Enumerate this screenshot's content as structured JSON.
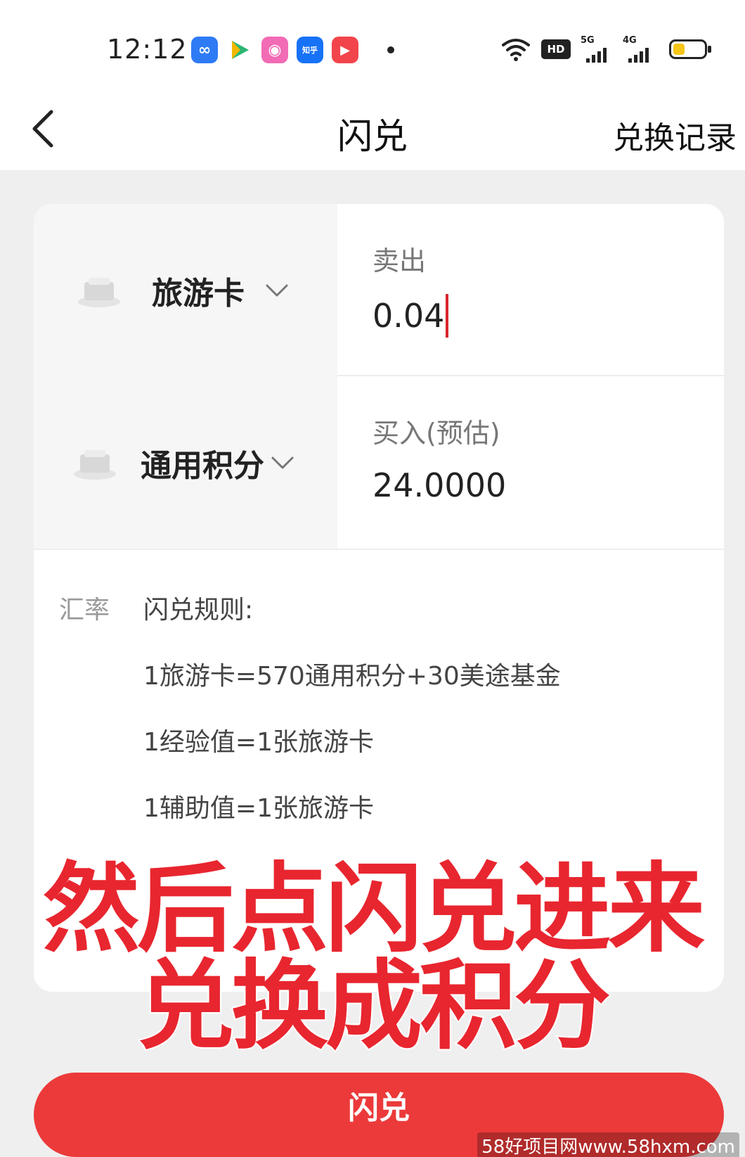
{
  "status_bar": {
    "time": "12:12",
    "app_icons": [
      {
        "name": "infinity-app-icon",
        "glyph": "∞",
        "color": "#2f7bf6"
      },
      {
        "name": "video-play-app-icon",
        "glyph": "▶",
        "color": "#2bb673"
      },
      {
        "name": "pink-app-icon",
        "glyph": "◉",
        "color": "#f26bb5"
      },
      {
        "name": "zhihu-app-icon",
        "glyph": "知乎",
        "color": "#1772f6"
      },
      {
        "name": "red-play-app-icon",
        "glyph": "▶",
        "color": "#f2454b"
      }
    ],
    "hd_label": "HD",
    "network_1": "5G",
    "network_2": "4G"
  },
  "nav": {
    "title": "闪兑",
    "right_action": "兑换记录"
  },
  "sell": {
    "asset": "旅游卡",
    "label": "卖出",
    "value": "0.04"
  },
  "buy": {
    "asset": "通用积分",
    "label": "买入(预估)",
    "value": "24.0000"
  },
  "rules": {
    "rate_label": "汇率",
    "title": "闪兑规则:",
    "items": [
      "1旅游卡=570通用积分+30美途基金",
      "1经验值=1张旅游卡",
      "1辅助值=1张旅游卡"
    ]
  },
  "caption": {
    "line1": "然后点闪兑进来",
    "line2": "兑换成积分"
  },
  "submit": {
    "label": "闪兑"
  },
  "watermark": "58好项目网www.58hxm.com",
  "colors": {
    "accent": "#ec3a3a",
    "caption_red": "#e8262f",
    "caret": "#d9262c"
  }
}
